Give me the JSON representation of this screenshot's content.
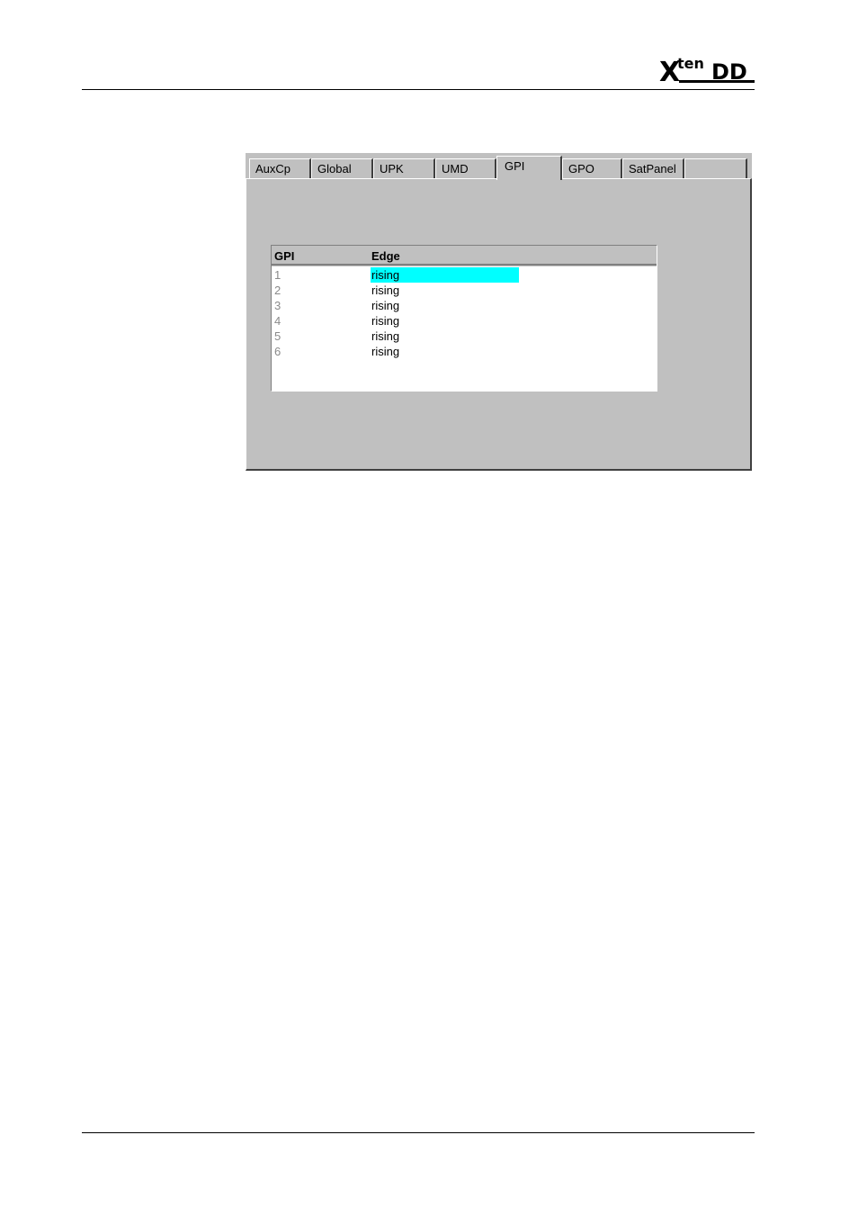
{
  "logo": {
    "text": "Xten DD",
    "icon": "xten-dd-logo"
  },
  "tabs": [
    {
      "label": "AuxCp"
    },
    {
      "label": "Global"
    },
    {
      "label": "UPK"
    },
    {
      "label": "UMD"
    },
    {
      "label": "GPI",
      "active": true
    },
    {
      "label": "GPO"
    },
    {
      "label": "SatPanel"
    },
    {
      "label": ""
    }
  ],
  "table": {
    "headers": {
      "gpi": "GPI",
      "edge": "Edge"
    },
    "rows": [
      {
        "gpi": "1",
        "edge": "rising",
        "selected": true
      },
      {
        "gpi": "2",
        "edge": "rising"
      },
      {
        "gpi": "3",
        "edge": "rising"
      },
      {
        "gpi": "4",
        "edge": "rising"
      },
      {
        "gpi": "5",
        "edge": "rising"
      },
      {
        "gpi": "6",
        "edge": "rising"
      }
    ]
  },
  "colors": {
    "panel": "#c0c0c0",
    "selection": "#00ffff"
  }
}
